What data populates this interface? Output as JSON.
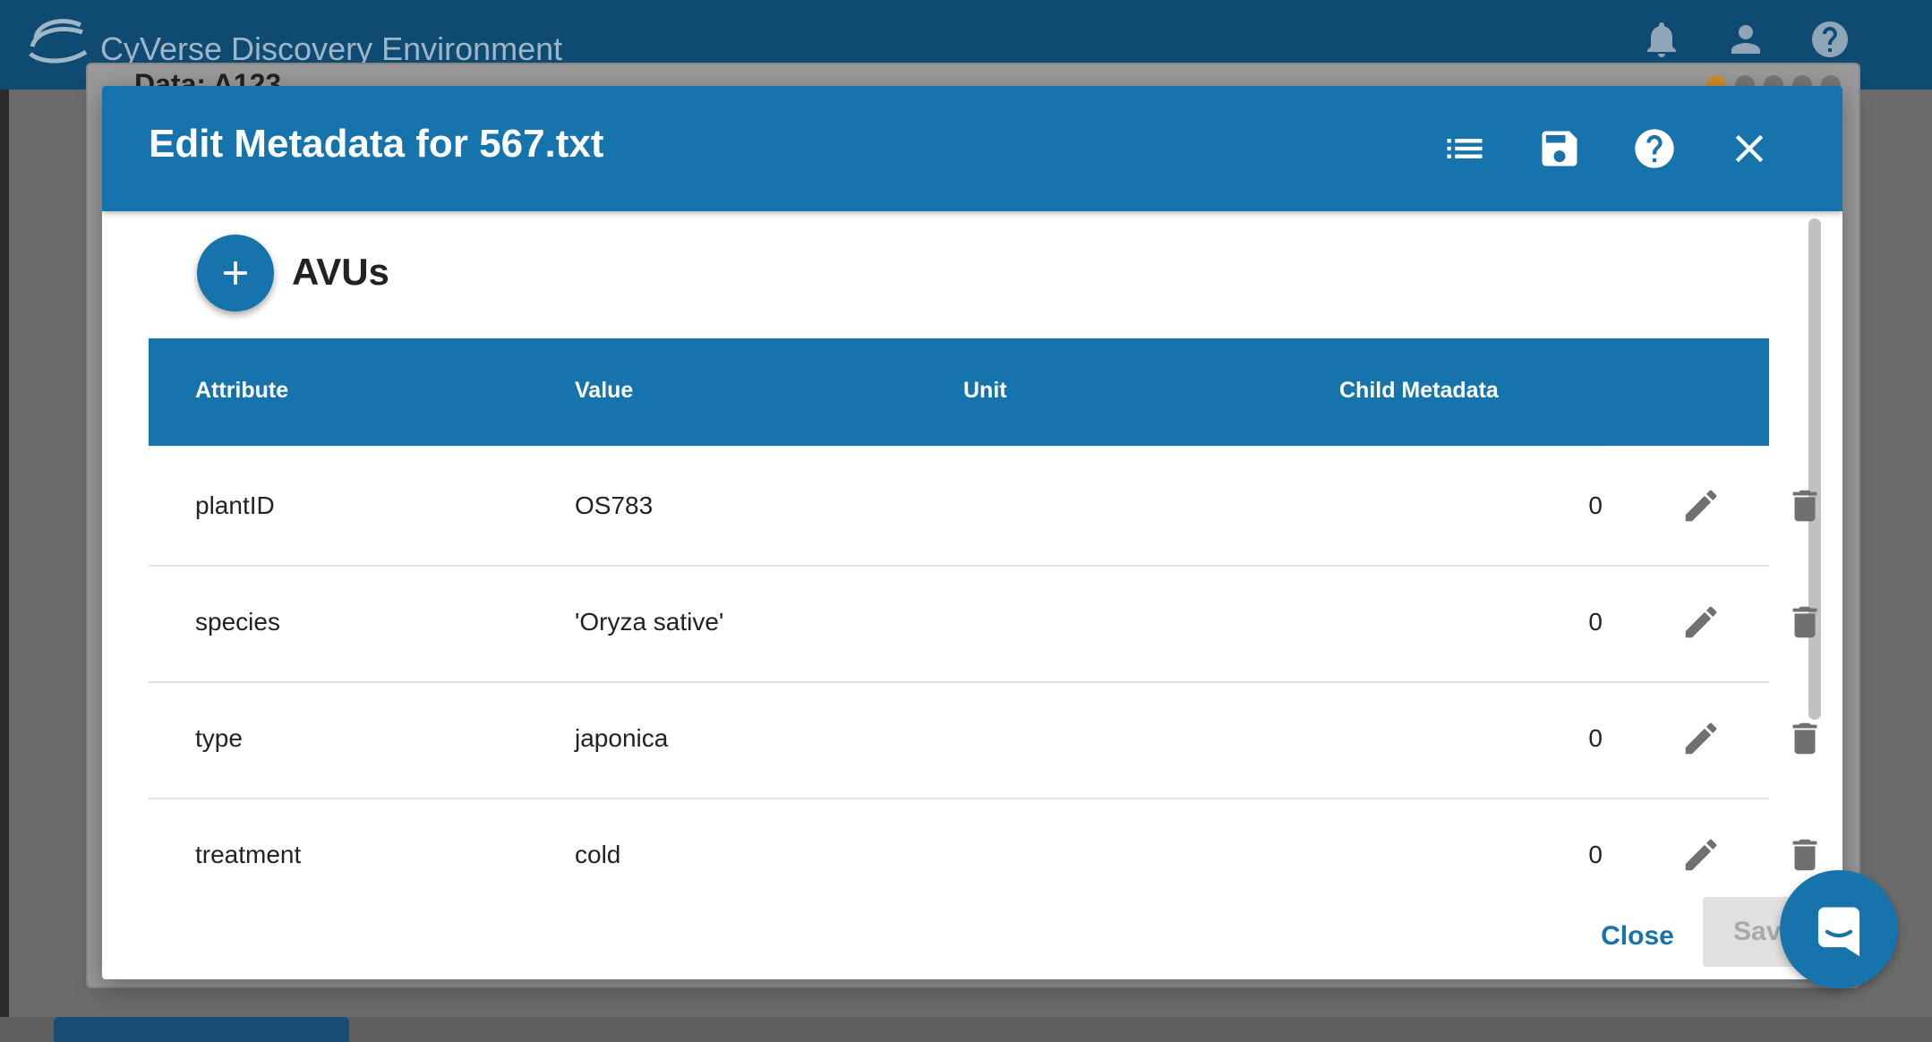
{
  "app": {
    "title": "CyVerse Discovery Environment",
    "window_title": "Data: A123",
    "taskbar_label": "Data: A123",
    "icons": [
      "bell-icon",
      "user-icon",
      "help-icon"
    ]
  },
  "dialog": {
    "title": "Edit Metadata for 567.txt",
    "header_icons": [
      "list-icon",
      "save-icon",
      "help-icon",
      "close-icon"
    ],
    "section_title": "AVUs",
    "columns": {
      "attribute": "Attribute",
      "value": "Value",
      "unit": "Unit",
      "child": "Child Metadata"
    },
    "rows": [
      {
        "attribute": "plantID",
        "value": "OS783",
        "unit": "",
        "child": "0"
      },
      {
        "attribute": "species",
        "value": "'Oryza sative'",
        "unit": "",
        "child": "0"
      },
      {
        "attribute": "type",
        "value": "japonica",
        "unit": "",
        "child": "0"
      },
      {
        "attribute": "treatment",
        "value": "cold",
        "unit": "",
        "child": "0"
      }
    ],
    "close_label": "Close",
    "save_label": "Save"
  },
  "colors": {
    "primary": "#1773ab",
    "topbar": "#0f4a72",
    "icon_gray": "#707070"
  }
}
